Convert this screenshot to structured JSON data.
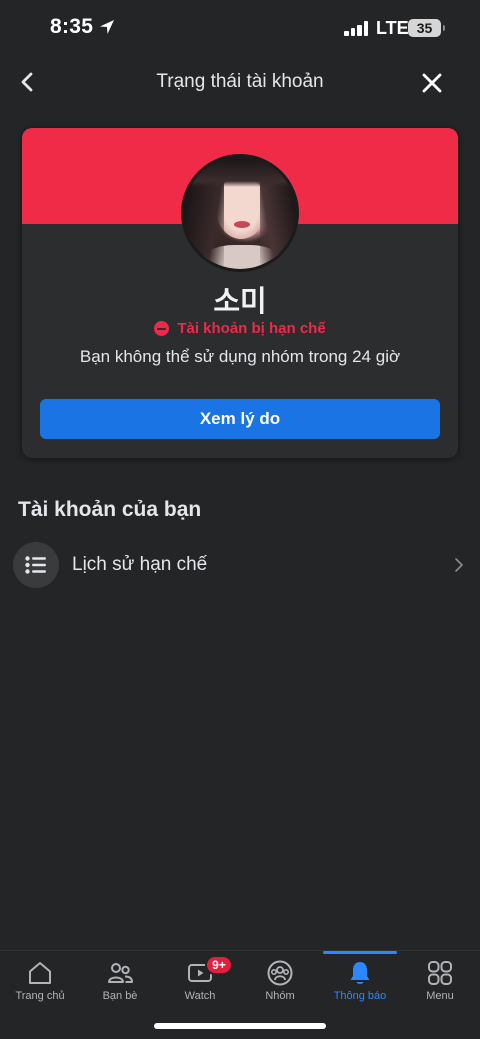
{
  "status_bar": {
    "time": "8:35",
    "network": "LTE",
    "battery": "35"
  },
  "header": {
    "title": "Trạng thái tài khoản",
    "back_icon": "chevron-left-icon",
    "close_icon": "close-icon"
  },
  "status_card": {
    "banner_color": "#ef2b48",
    "name": "소미",
    "restriction_label": "Tài khoản bị hạn chế",
    "restriction_color": "#f02849",
    "description": "Bạn không thể sử dụng nhóm trong 24 giờ",
    "button_label": "Xem lý do",
    "button_color": "#1b74e4"
  },
  "account_section": {
    "title": "Tài khoản của bạn",
    "items": [
      {
        "label": "Lịch sử hạn chế",
        "icon": "list-icon"
      }
    ]
  },
  "tab_bar": {
    "accent": "#2d88ff",
    "tabs": [
      {
        "label": "Trang chủ",
        "icon": "home-icon"
      },
      {
        "label": "Bạn bè",
        "icon": "friends-icon"
      },
      {
        "label": "Watch",
        "icon": "watch-icon",
        "badge": "9+"
      },
      {
        "label": "Nhóm",
        "icon": "groups-icon"
      },
      {
        "label": "Thông báo",
        "icon": "bell-icon",
        "active": true
      },
      {
        "label": "Menu",
        "icon": "menu-grid-icon"
      }
    ]
  }
}
